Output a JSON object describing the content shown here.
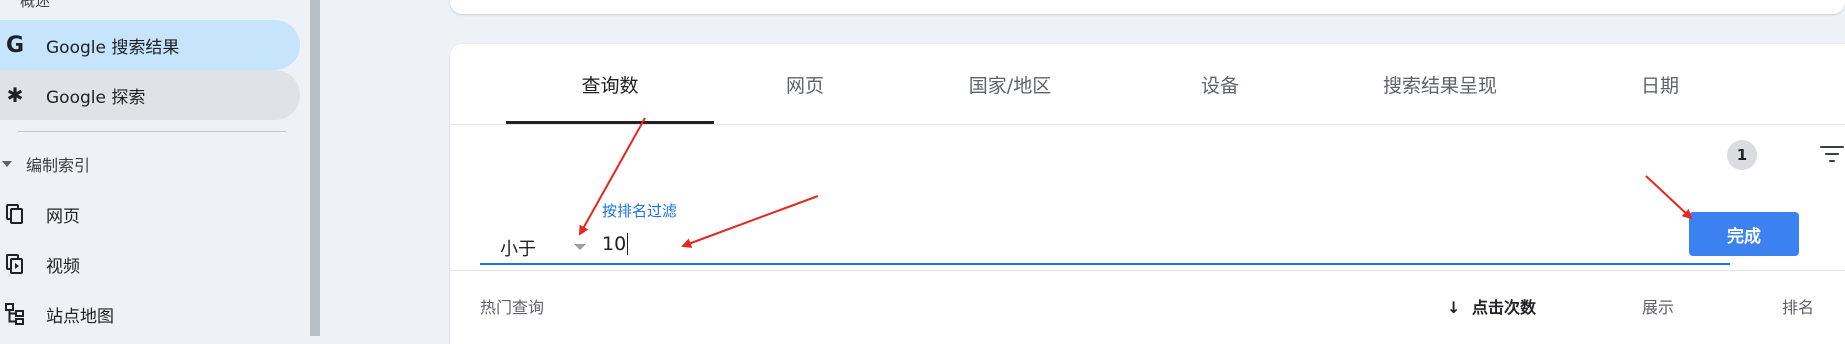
{
  "sidebar": {
    "top_clipped": "概述",
    "items": [
      {
        "label": "Google 搜索结果",
        "icon": "google-g-icon",
        "glyph": "G"
      },
      {
        "label": "Google 探索",
        "icon": "asterisk-icon",
        "glyph": "✱"
      }
    ],
    "section_label": "编制索引",
    "index_items": [
      {
        "label": "网页",
        "icon": "pages-icon"
      },
      {
        "label": "视频",
        "icon": "video-icon"
      },
      {
        "label": "站点地图",
        "icon": "sitemap-icon"
      }
    ]
  },
  "tabs": [
    "查询数",
    "网页",
    "国家/地区",
    "设备",
    "搜索结果呈现",
    "日期"
  ],
  "active_tab": "查询数",
  "filter_count": "1",
  "filter": {
    "label": "按排名过滤",
    "operator": "小于",
    "value": "10"
  },
  "done_label": "完成",
  "table_headers": {
    "top_queries": "热门查询",
    "clicks": "点击次数",
    "sort_arrow": "↓",
    "impressions": "展示",
    "position": "排名"
  },
  "colors": {
    "active_nav_bg": "#c6e4fb",
    "accent_blue": "#1a73e8",
    "done_button": "#3b82f0",
    "annotation_arrow": "#e8261c"
  }
}
